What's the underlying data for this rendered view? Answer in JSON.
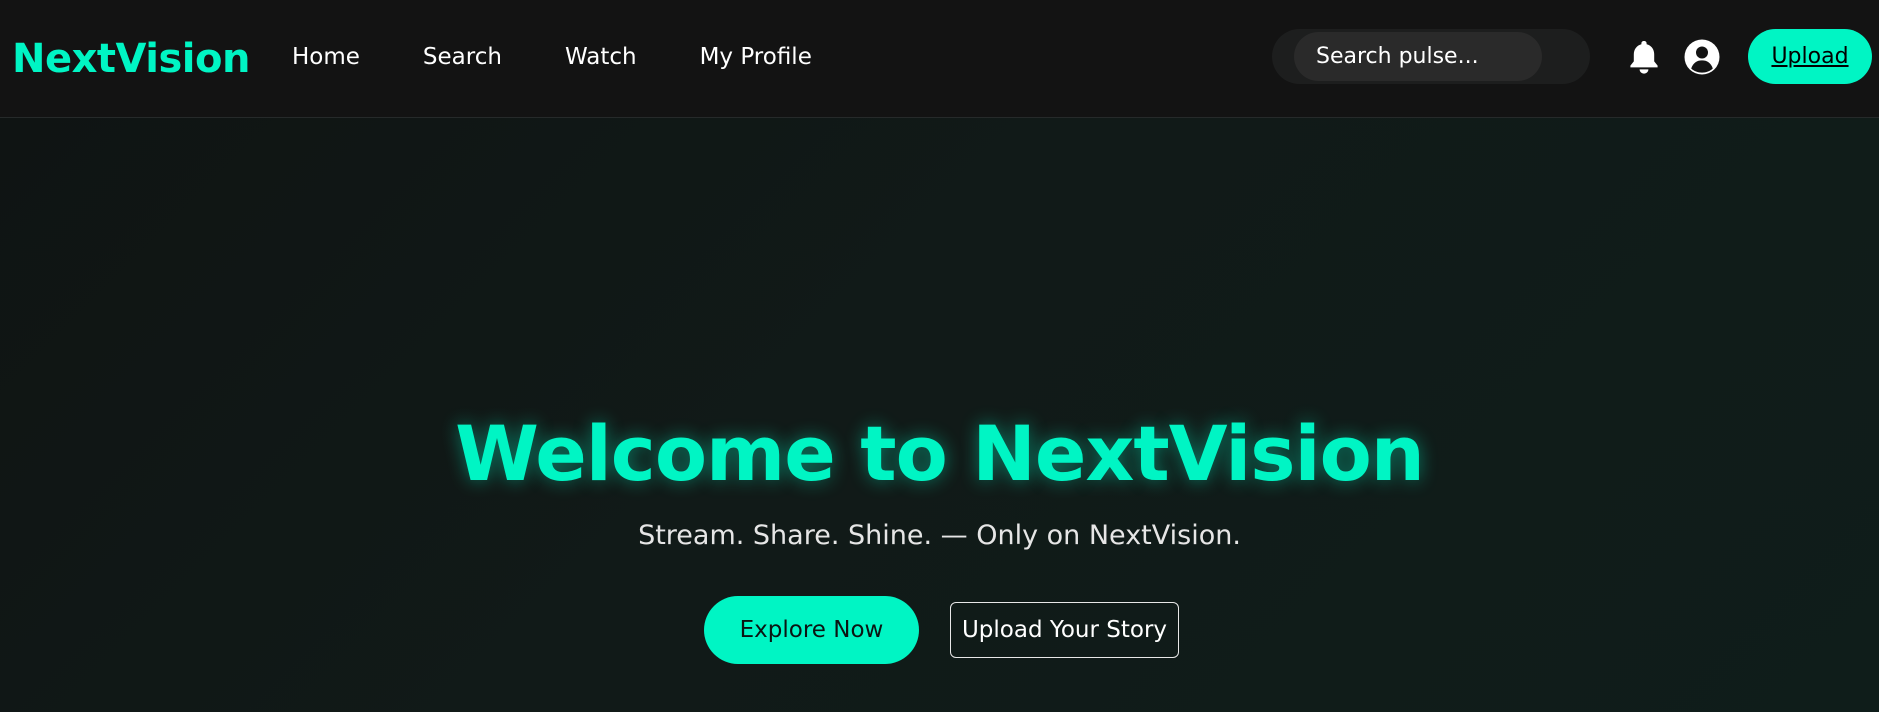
{
  "brand": {
    "name": "NextVision",
    "accent_color": "#00f5c4"
  },
  "nav": {
    "links": [
      {
        "label": "Home"
      },
      {
        "label": "Search"
      },
      {
        "label": "Watch"
      },
      {
        "label": "My Profile"
      }
    ]
  },
  "search": {
    "placeholder": "Search pulse..."
  },
  "header_icons": {
    "notifications": "bell-icon",
    "profile": "user-circle-icon"
  },
  "header": {
    "upload_label": "Upload"
  },
  "hero": {
    "title": "Welcome to NextVision",
    "subtitle": "Stream. Share. Shine. — Only on NextVision.",
    "primary_cta": "Explore Now",
    "secondary_cta": "Upload Your Story"
  }
}
